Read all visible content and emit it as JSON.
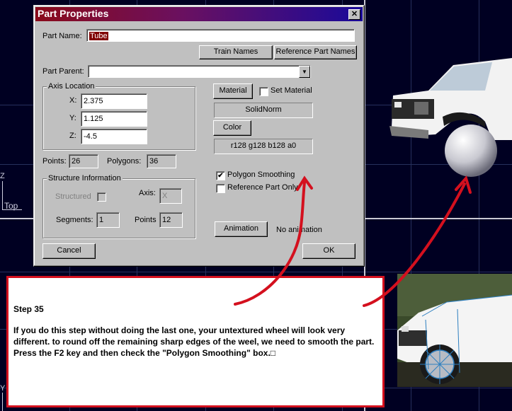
{
  "dialog": {
    "title": "Part Properties",
    "close_symbol": "✕",
    "part_name_label": "Part Name:",
    "part_name_value": "Tube",
    "train_names_button": "Train Names",
    "reference_part_names_button": "Reference Part Names",
    "part_parent_label": "Part Parent:",
    "part_parent_value": "",
    "axis_location": {
      "title": "Axis Location",
      "x_label": "X:",
      "x_value": "2.375",
      "y_label": "Y:",
      "y_value": "1.125",
      "z_label": "Z:",
      "z_value": "-4.5"
    },
    "points_label": "Points:",
    "points_value": "26",
    "polygons_label": "Polygons:",
    "polygons_value": "36",
    "structure": {
      "title": "Structure Information",
      "structured_label": "Structured",
      "axis_label": "Axis:",
      "axis_value": "X",
      "segments_label": "Segments:",
      "segments_value": "1",
      "points_label": "Points",
      "points_value": "12"
    },
    "material_button": "Material",
    "set_material_label": "Set Material",
    "material_value": "SolidNorm",
    "color_button": "Color",
    "color_value": "r128 g128 b128 a0",
    "polygon_smoothing_label": "Polygon Smoothing",
    "polygon_smoothing_checked": "✔",
    "reference_part_only_label": "Reference Part Only",
    "animation_button": "Animation",
    "animation_status": "No animation",
    "cancel_button": "Cancel",
    "ok_button": "OK"
  },
  "viewport": {
    "axis_z": "Z",
    "axis_top": "Top",
    "axis_y": "Y"
  },
  "note": {
    "step": "Step 35",
    "body": "If you do this step without doing the last one, your untextured wheel will look very different. to round off the remaining sharp edges of the weel, we need to smooth the part. Press the F2 key and then check the \"Polygon Smoothing\" box.□"
  },
  "colors": {
    "dialog_bg": "#c0c0c0",
    "title_gradient_start": "#8a0a1a",
    "title_gradient_end": "#1a0a9a",
    "annotation_red": "#d4101e",
    "viewport_bg": "#000022"
  }
}
